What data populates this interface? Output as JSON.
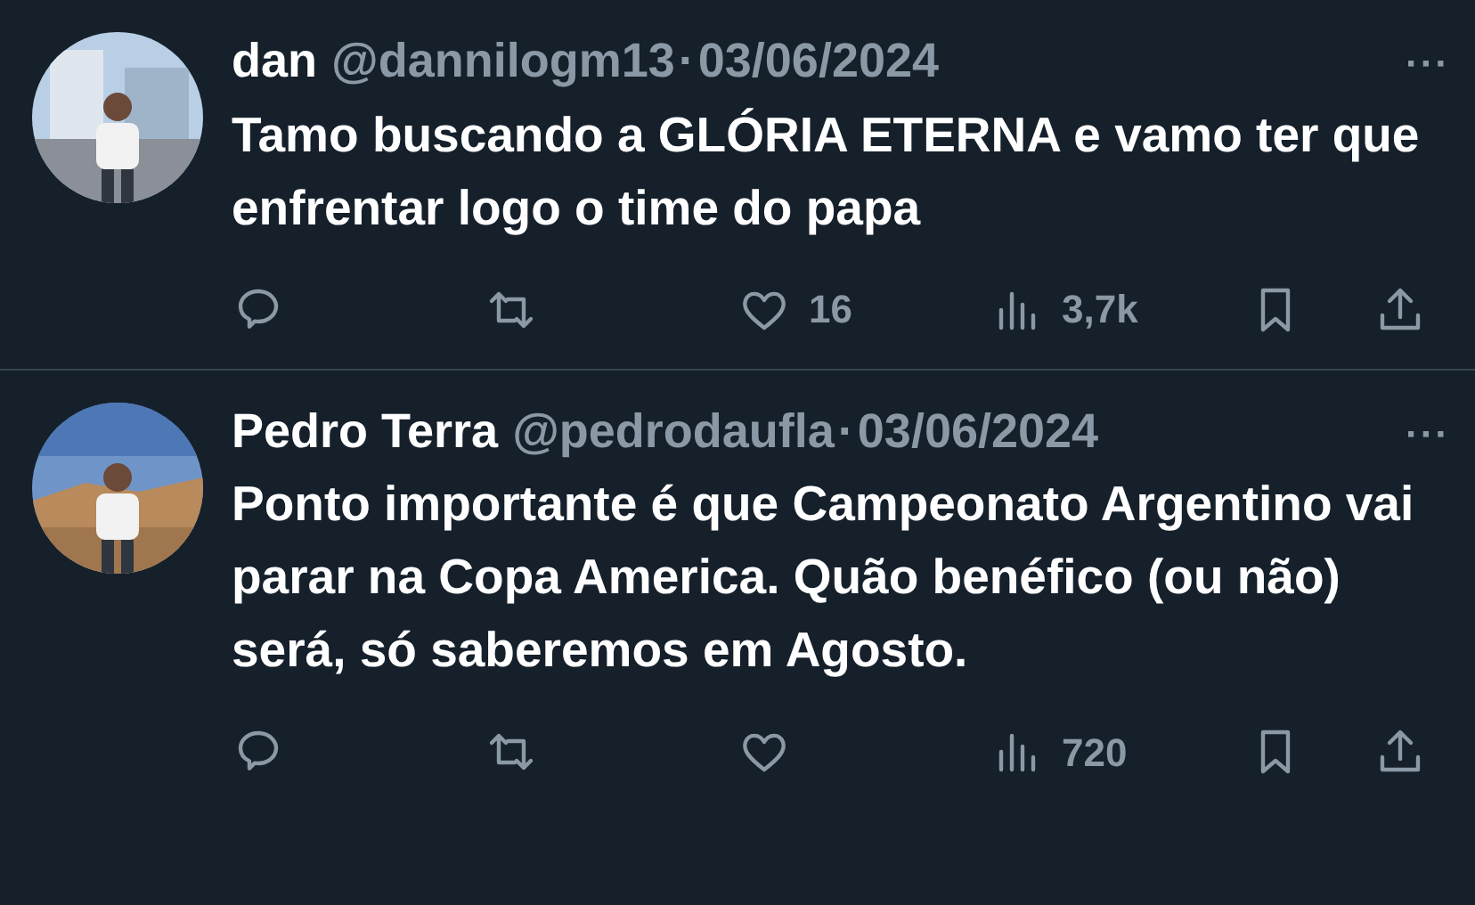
{
  "tweets": [
    {
      "name": "dan",
      "handle": "@dannilogm13",
      "separator": "·",
      "date": "03/06/2024",
      "more": "···",
      "text": "Tamo buscando a GLÓRIA ETERNA e vamo ter que enfrentar logo o time do papa",
      "likes": "16",
      "views": "3,7k"
    },
    {
      "name": "Pedro Terra",
      "handle": "@pedrodaufla",
      "separator": "·",
      "date": "03/06/2024",
      "more": "···",
      "text": "Ponto importante é que Campeonato Argentino vai parar na Copa America. Quão benéfico (ou não) será, só saberemos em Agosto.",
      "views": "720"
    }
  ]
}
